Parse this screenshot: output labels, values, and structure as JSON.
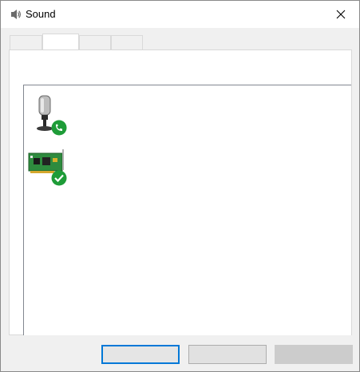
{
  "window": {
    "title": "Sound",
    "title_icon": "speaker-icon",
    "close_icon": "close-icon"
  },
  "tabs": [
    {
      "label": "",
      "selected": false
    },
    {
      "label": "",
      "selected": true
    },
    {
      "label": "",
      "selected": false
    },
    {
      "label": "",
      "selected": false
    }
  ],
  "devices": [
    {
      "icon": "microphone-icon",
      "status_icon": "phone-status-icon",
      "status_color": "#1e9c38",
      "name": "",
      "description": "",
      "status": ""
    },
    {
      "icon": "sound-card-icon",
      "status_icon": "checkmark-status-icon",
      "status_color": "#1e9c38",
      "name": "",
      "description": "",
      "status": ""
    }
  ],
  "buttons": {
    "ok": "",
    "cancel": "",
    "apply": ""
  },
  "colors": {
    "accent": "#0078d7",
    "status_green": "#1e9c38"
  }
}
